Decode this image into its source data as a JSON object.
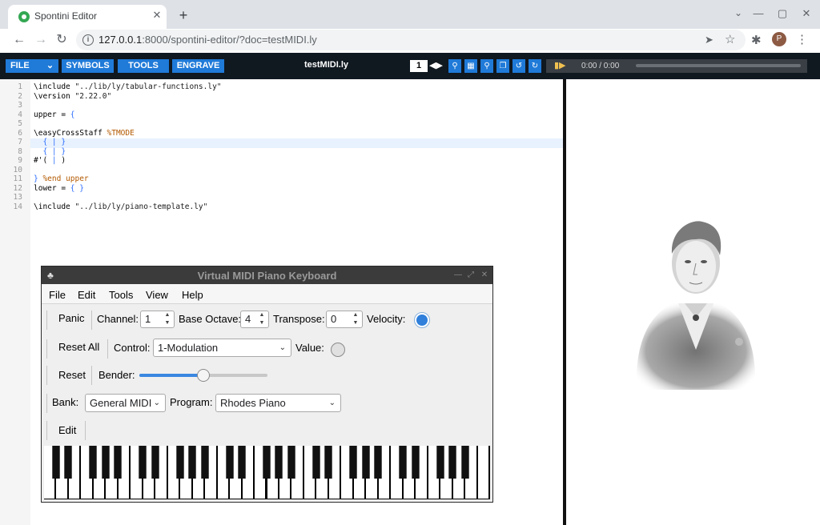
{
  "browser": {
    "tab_title": "Spontini Editor",
    "url_host": "127.0.0.1",
    "url_rest": ":8000/spontini-editor/?doc=testMIDI.ly"
  },
  "app_toolbar": {
    "menus": [
      "FILE",
      "SYMBOLS",
      "TOOLS",
      "ENGRAVE"
    ],
    "doc_title": "testMIDI.ly",
    "page": "1",
    "player_time": "0:00 / 0:00",
    "accent_color": "#1f7ad8"
  },
  "editor": {
    "lines": [
      {
        "n": "1",
        "parts": [
          [
            "kw",
            "\\include "
          ],
          [
            "str",
            "\"../lib/ly/tabular-functions.ly\""
          ]
        ]
      },
      {
        "n": "2",
        "parts": [
          [
            "kw",
            "\\version "
          ],
          [
            "str",
            "\"2.22.0\""
          ]
        ]
      },
      {
        "n": "3",
        "parts": []
      },
      {
        "n": "4",
        "parts": [
          [
            "kw",
            "upper = "
          ],
          [
            "br",
            "{"
          ]
        ]
      },
      {
        "n": "5",
        "parts": []
      },
      {
        "n": "6",
        "parts": [
          [
            "kw",
            "\\easyCrossStaff "
          ],
          [
            "cm",
            "%TMODE"
          ]
        ]
      },
      {
        "n": "7",
        "parts": [
          [
            "kw",
            "  "
          ],
          [
            "br",
            "{ | }"
          ]
        ]
      },
      {
        "n": "8",
        "parts": [
          [
            "kw",
            "  "
          ],
          [
            "br",
            "{ | }"
          ]
        ]
      },
      {
        "n": "9",
        "parts": [
          [
            "kw",
            "#'( "
          ],
          [
            "br",
            "|"
          ],
          [
            "kw",
            " )"
          ]
        ]
      },
      {
        "n": "10",
        "parts": []
      },
      {
        "n": "11",
        "parts": [
          [
            "br",
            "}"
          ],
          [
            "cm",
            " %end upper"
          ]
        ]
      },
      {
        "n": "12",
        "parts": [
          [
            "kw",
            "lower = "
          ],
          [
            "br",
            "{ }"
          ]
        ]
      },
      {
        "n": "13",
        "parts": []
      },
      {
        "n": "14",
        "parts": [
          [
            "kw",
            "\\include "
          ],
          [
            "str",
            "\"../lib/ly/piano-template.ly\""
          ]
        ]
      }
    ]
  },
  "vmpk": {
    "title": "Virtual MIDI Piano Keyboard",
    "menu": [
      "File",
      "Edit",
      "Tools",
      "View",
      "Help"
    ],
    "panic": "Panic",
    "channel_label": "Channel:",
    "channel_value": "1",
    "base_octave_label": "Base Octave:",
    "base_octave_value": "4",
    "transpose_label": "Transpose:",
    "transpose_value": "0",
    "velocity_label": "Velocity:",
    "reset_all": "Reset All",
    "control_label": "Control:",
    "control_value": "1-Modulation",
    "value_label": "Value:",
    "reset": "Reset",
    "bender_label": "Bender:",
    "bender_level": 0.5,
    "bank_label": "Bank:",
    "bank_value": "General MIDI",
    "program_label": "Program:",
    "program_value": "Rhodes Piano",
    "edit": "Edit",
    "white_keys": 36
  }
}
